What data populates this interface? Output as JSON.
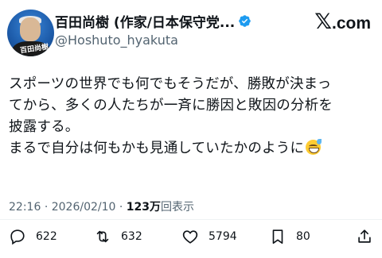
{
  "user": {
    "display_name": "百田尚樹 (作家/日本保守党...",
    "handle": "@Hoshuto_hyakuta",
    "avatar_signature": "百田尚樹",
    "verified_icon": "verified-badge-icon"
  },
  "brand": {
    "x": "𝕏",
    "com": ".com"
  },
  "tweet": {
    "lines": [
      "スポーツの世界でも何でもそうだが、勝敗が決まっ",
      "てから、多くの人たちが一斉に勝因と敗因の分析を",
      "披露する。",
      "まるで自分は何もかも見通していたかのように"
    ],
    "emoji": "grinning-sweat-emoji"
  },
  "meta": {
    "time": "22:16",
    "separator": "·",
    "date": "2026/02/10",
    "views": "123万",
    "views_label": "回表示"
  },
  "actions": {
    "replies": "622",
    "retweets": "632",
    "likes": "5794",
    "bookmarks": "80"
  },
  "colors": {
    "text": "#0f1419",
    "secondary": "#536471",
    "verified": "#1d9bf0"
  }
}
